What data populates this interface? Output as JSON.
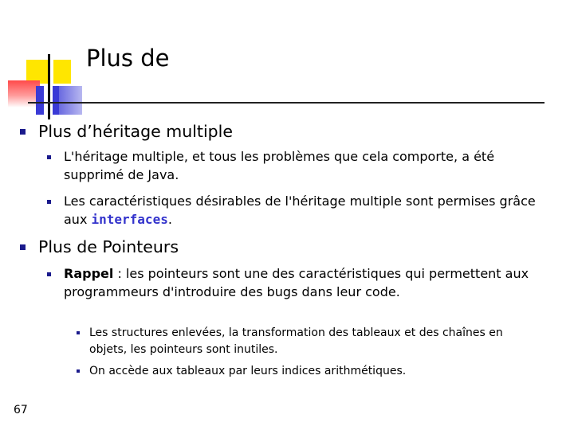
{
  "slide": {
    "title": "Plus de",
    "page_number": "67",
    "sections": [
      {
        "heading": "Plus d’héritage multiple",
        "points": [
          {
            "text": "L'héritage multiple, et tous les problèmes que cela comporte, a été supprimé de Java."
          },
          {
            "text_before": "Les caractéristiques désirables de l'héritage multiple sont permises grâce aux ",
            "keyword": "interfaces",
            "text_after": "."
          }
        ]
      },
      {
        "heading": "Plus de Pointeurs",
        "points": [
          {
            "label": "Rappel",
            "text": " : les pointeurs sont une des caractéristiques qui permettent aux programmeurs d'introduire des bugs dans leur code."
          }
        ],
        "subpoints": [
          {
            "text": "Les structures enlevées, la transformation des tableaux et des chaînes en objets, les pointeurs sont inutiles."
          },
          {
            "text": "On accède aux tableaux par leurs indices arithmétiques."
          }
        ]
      }
    ]
  },
  "colors": {
    "keyword": "#3333cc",
    "bullet": "#1a1a8c",
    "deco_yellow": "#ffe600",
    "deco_red": "#ff4a4a",
    "deco_blue": "#3a3ad6"
  }
}
